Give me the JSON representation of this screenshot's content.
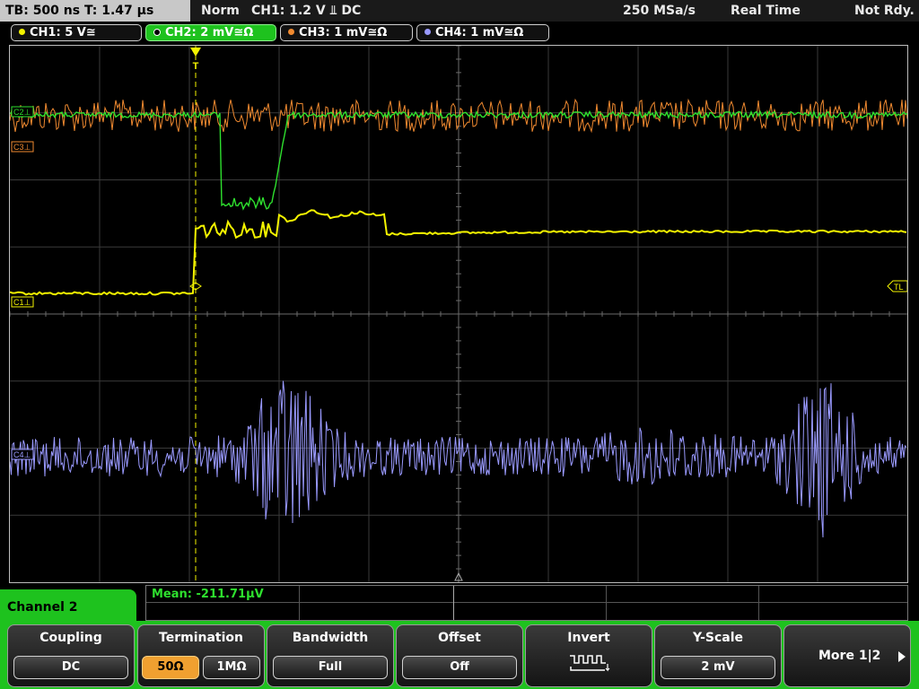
{
  "status": {
    "timebase": "TB: 500 ns   T: 1.47 µs",
    "trigger_mode": "Norm",
    "trigger_source": "CH1: 1.2 V ⫫ DC",
    "sample_rate": "250 MSa/s",
    "acq_mode": "Real Time",
    "ready": "Not Rdy."
  },
  "channels": [
    {
      "label": "CH1: 5 V≅",
      "color": "#f4f400"
    },
    {
      "label": "CH2: 2 mV≅Ω",
      "color": "#2ee02e",
      "active": true
    },
    {
      "label": "CH3: 1 mV≅Ω",
      "color": "#f08a30"
    },
    {
      "label": "CH4: 1 mV≅Ω",
      "color": "#9a9aff"
    }
  ],
  "markers": {
    "c1": "C1⊥",
    "c2": "C2⊥",
    "c3": "C3⊥",
    "c4": "C4⊥",
    "trigger_level": "TL",
    "trigger_position": "T"
  },
  "measurement": {
    "mean": "Mean: -211.71µV"
  },
  "menu": {
    "title": "Channel 2",
    "coupling": {
      "label": "Coupling",
      "value": "DC"
    },
    "termination": {
      "label": "Termination",
      "opt1": "50Ω",
      "opt2": "1MΩ",
      "selected": "50Ω"
    },
    "bandwidth": {
      "label": "Bandwidth",
      "value": "Full"
    },
    "offset": {
      "label": "Offset",
      "value": "Off"
    },
    "invert": {
      "label": "Invert",
      "icon": "square-wave-icon"
    },
    "yscale": {
      "label": "Y-Scale",
      "value": "2 mV"
    },
    "more": {
      "label": "More 1|2",
      "icon": "play-right-icon"
    }
  }
}
